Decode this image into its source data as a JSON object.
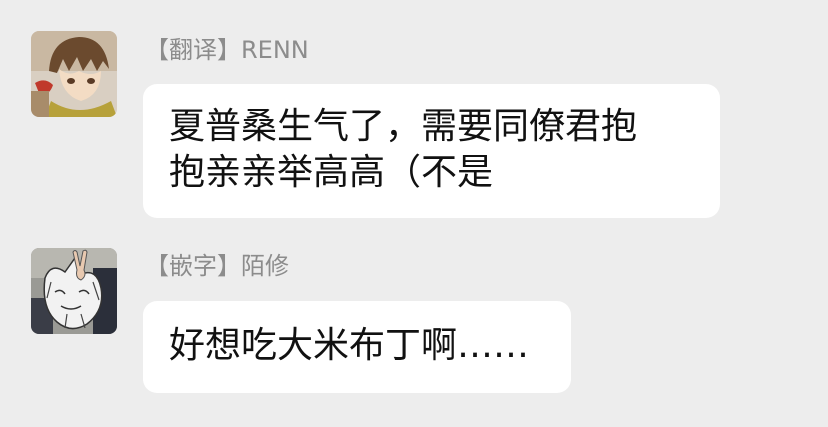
{
  "messages": [
    {
      "sender": "【翻译】RENN",
      "avatar_icon": "anime-character-avatar",
      "lines": [
        "夏普桑生气了，需要同僚君抱",
        "抱亲亲举高高（不是"
      ]
    },
    {
      "sender": "【嵌字】陌修",
      "avatar_icon": "sketch-peace-sign-avatar",
      "lines": [
        "好想吃大米布丁啊……"
      ]
    }
  ]
}
